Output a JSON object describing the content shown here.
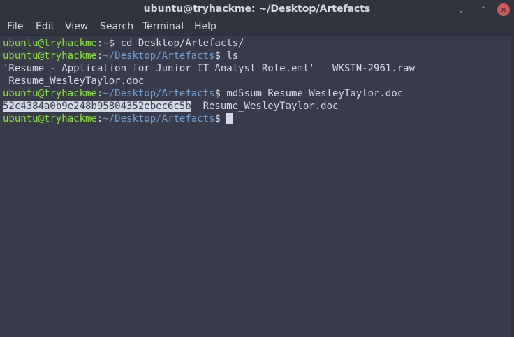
{
  "window": {
    "title": "ubuntu@tryhackme: ~/Desktop/Artefacts",
    "close_glyph": "✕",
    "min_glyph": "⌄",
    "max_glyph": "⌃"
  },
  "menu": {
    "items": [
      "File",
      "Edit",
      "View",
      "Search",
      "Terminal",
      "Help"
    ]
  },
  "prompt": {
    "user_host": "ubuntu@tryhackme",
    "separator": ":",
    "home_path": "~",
    "artefacts_path": "~/Desktop/Artefacts",
    "symbol": "$"
  },
  "terminal": {
    "cmd1": " cd Desktop/Artefacts/",
    "cmd2": " ls",
    "ls_line1": "'Resume - Application for Junior IT Analyst Role.eml'   WKSTN-2961.raw",
    "ls_line2": " Resume_WesleyTaylor.doc",
    "cmd3": " md5sum Resume_WesleyTaylor.doc",
    "md5_hash": "52c4384a0b9e248b95804352ebec6c5b",
    "md5_file": "  Resume_WesleyTaylor.doc",
    "trailing_space": " "
  },
  "colors": {
    "background": "#383c4a",
    "titlebar": "#2f343f",
    "user": "#8ae234",
    "path": "#729fcf",
    "text": "#d3dae3"
  }
}
